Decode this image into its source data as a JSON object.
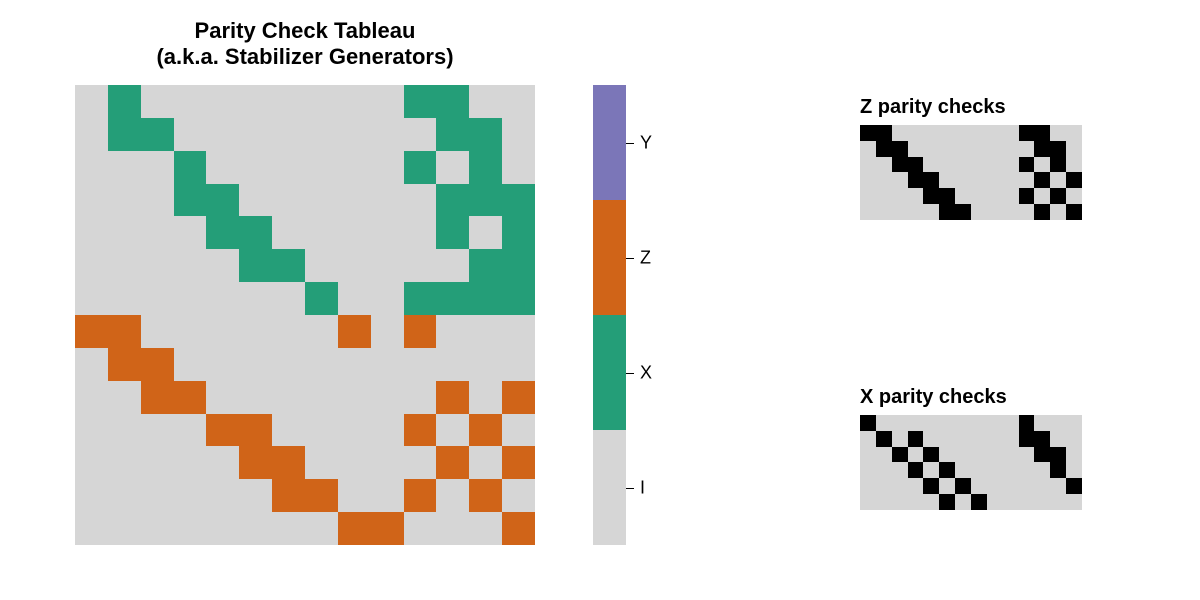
{
  "titles": {
    "main_line1": "Parity Check Tableau",
    "main_line2": "(a.k.a. Stabilizer Generators)",
    "z": "Z parity checks",
    "x": "X parity checks"
  },
  "legend": {
    "labels": [
      "Y",
      "Z",
      "X",
      "I"
    ]
  },
  "colors": {
    "I": "#d6d6d6",
    "X": "#249e78",
    "Z": "#d06418",
    "Y": "#7b76b8",
    "K": "#000000"
  },
  "chart_data": {
    "type": "heatmap",
    "title": "Parity Check Tableau (a.k.a. Stabilizer Generators)",
    "main": {
      "rows": 14,
      "cols": 14,
      "legend_values": [
        "I",
        "X",
        "Z",
        "Y"
      ],
      "cells": [
        [
          "I",
          "X",
          "I",
          "I",
          "I",
          "I",
          "I",
          "I",
          "I",
          "I",
          "X",
          "X",
          "I",
          "I"
        ],
        [
          "I",
          "X",
          "X",
          "I",
          "I",
          "I",
          "I",
          "I",
          "I",
          "I",
          "I",
          "X",
          "X",
          "I"
        ],
        [
          "I",
          "I",
          "I",
          "X",
          "I",
          "I",
          "I",
          "I",
          "I",
          "I",
          "X",
          "I",
          "X",
          "I"
        ],
        [
          "I",
          "I",
          "I",
          "X",
          "X",
          "I",
          "I",
          "I",
          "I",
          "I",
          "I",
          "X",
          "X",
          "X"
        ],
        [
          "I",
          "I",
          "I",
          "I",
          "X",
          "X",
          "I",
          "I",
          "I",
          "I",
          "I",
          "X",
          "I",
          "X"
        ],
        [
          "I",
          "I",
          "I",
          "I",
          "I",
          "X",
          "X",
          "I",
          "I",
          "I",
          "I",
          "I",
          "X",
          "X"
        ],
        [
          "I",
          "I",
          "I",
          "I",
          "I",
          "I",
          "I",
          "X",
          "I",
          "I",
          "X",
          "X",
          "X",
          "X"
        ],
        [
          "Z",
          "Z",
          "I",
          "I",
          "I",
          "I",
          "I",
          "I",
          "Z",
          "I",
          "Z",
          "I",
          "I",
          "I"
        ],
        [
          "I",
          "Z",
          "Z",
          "I",
          "I",
          "I",
          "I",
          "I",
          "I",
          "I",
          "I",
          "I",
          "I",
          "I"
        ],
        [
          "I",
          "I",
          "Z",
          "Z",
          "I",
          "I",
          "I",
          "I",
          "I",
          "I",
          "I",
          "Z",
          "I",
          "Z"
        ],
        [
          "I",
          "I",
          "I",
          "I",
          "Z",
          "Z",
          "I",
          "I",
          "I",
          "I",
          "Z",
          "I",
          "Z",
          "I"
        ],
        [
          "I",
          "I",
          "I",
          "I",
          "I",
          "Z",
          "Z",
          "I",
          "I",
          "I",
          "I",
          "Z",
          "I",
          "Z"
        ],
        [
          "I",
          "I",
          "I",
          "I",
          "I",
          "I",
          "Z",
          "Z",
          "I",
          "I",
          "Z",
          "I",
          "Z",
          "I"
        ],
        [
          "I",
          "I",
          "I",
          "I",
          "I",
          "I",
          "I",
          "I",
          "Z",
          "Z",
          "I",
          "I",
          "I",
          "Z"
        ]
      ]
    },
    "z_checks": {
      "title": "Z parity checks",
      "rows": 6,
      "cols": 14,
      "cells": [
        [
          "K",
          "K",
          "I",
          "I",
          "I",
          "I",
          "I",
          "I",
          "I",
          "I",
          "K",
          "K",
          "I",
          "I"
        ],
        [
          "I",
          "K",
          "K",
          "I",
          "I",
          "I",
          "I",
          "I",
          "I",
          "I",
          "I",
          "K",
          "K",
          "I"
        ],
        [
          "I",
          "I",
          "K",
          "K",
          "I",
          "I",
          "I",
          "I",
          "I",
          "I",
          "K",
          "I",
          "K",
          "I"
        ],
        [
          "I",
          "I",
          "I",
          "K",
          "K",
          "I",
          "I",
          "I",
          "I",
          "I",
          "I",
          "K",
          "I",
          "K"
        ],
        [
          "I",
          "I",
          "I",
          "I",
          "K",
          "K",
          "I",
          "I",
          "I",
          "I",
          "K",
          "I",
          "K",
          "I"
        ],
        [
          "I",
          "I",
          "I",
          "I",
          "I",
          "K",
          "K",
          "I",
          "I",
          "I",
          "I",
          "K",
          "I",
          "K"
        ]
      ]
    },
    "x_checks": {
      "title": "X parity checks",
      "rows": 6,
      "cols": 14,
      "cells": [
        [
          "K",
          "I",
          "I",
          "I",
          "I",
          "I",
          "I",
          "I",
          "I",
          "I",
          "K",
          "I",
          "I",
          "I"
        ],
        [
          "I",
          "K",
          "I",
          "K",
          "I",
          "I",
          "I",
          "I",
          "I",
          "I",
          "K",
          "K",
          "I",
          "I"
        ],
        [
          "I",
          "I",
          "K",
          "I",
          "K",
          "I",
          "I",
          "I",
          "I",
          "I",
          "I",
          "K",
          "K",
          "I"
        ],
        [
          "I",
          "I",
          "I",
          "K",
          "I",
          "K",
          "I",
          "I",
          "I",
          "I",
          "I",
          "I",
          "K",
          "I"
        ],
        [
          "I",
          "I",
          "I",
          "I",
          "K",
          "I",
          "K",
          "I",
          "I",
          "I",
          "I",
          "I",
          "I",
          "K"
        ],
        [
          "I",
          "I",
          "I",
          "I",
          "I",
          "K",
          "I",
          "K",
          "I",
          "I",
          "I",
          "I",
          "I",
          "I"
        ]
      ]
    }
  }
}
